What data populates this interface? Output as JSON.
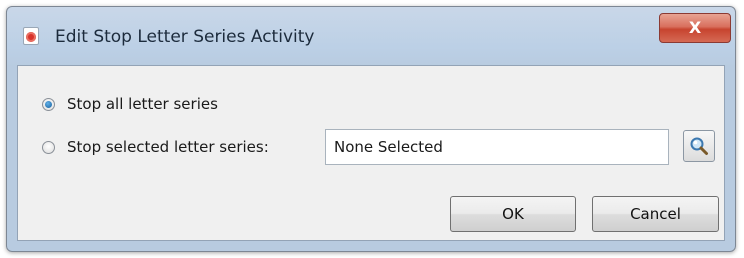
{
  "window": {
    "title": "Edit Stop Letter Series Activity",
    "close_label": "X"
  },
  "options": {
    "stop_all_label": "Stop all letter series",
    "stop_selected_label": "Stop selected letter series:",
    "selected_option": "stop_all"
  },
  "selection_field": {
    "value": "None Selected"
  },
  "buttons": {
    "ok_label": "OK",
    "cancel_label": "Cancel"
  },
  "icons": {
    "app": "app-record-icon",
    "search": "magnifier-icon"
  },
  "colors": {
    "title_bar": "#bcd0e6",
    "close_button": "#c7442f",
    "dialog_background": "#f0f0f0"
  }
}
